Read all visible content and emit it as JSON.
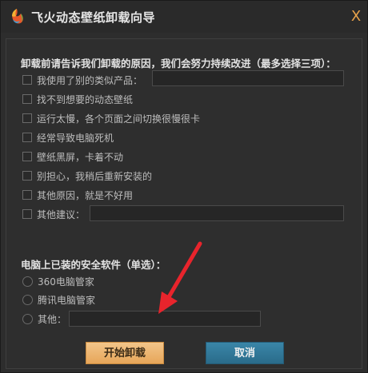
{
  "window": {
    "title": "飞火动态壁纸卸载向导",
    "close_glyph": "X"
  },
  "reasons": {
    "heading": "卸载前请告诉我们卸载的原因，我们会努力持续改进（最多选择三项）：",
    "options": [
      {
        "label": "我使用了别的类似产品：",
        "checked": false
      },
      {
        "label": "找不到想要的动态壁纸",
        "checked": false
      },
      {
        "label": "运行太慢，各个页面之间切换很慢很卡",
        "checked": false
      },
      {
        "label": "经常导致电脑死机",
        "checked": false
      },
      {
        "label": "壁纸黑屏，卡着不动",
        "checked": false
      },
      {
        "label": "别担心，我稍后重新安装的",
        "checked": false
      },
      {
        "label": "其他原因，就是不好用",
        "checked": false
      },
      {
        "label": "其他建议：",
        "checked": false
      }
    ],
    "similar_product_value": "",
    "suggestion_value": ""
  },
  "security": {
    "heading": "电脑上已装的安全软件（单选）：",
    "options": [
      {
        "label": "360电脑管家",
        "selected": false
      },
      {
        "label": "腾讯电脑管家",
        "selected": false
      },
      {
        "label": "其他：",
        "selected": false
      }
    ],
    "other_value": ""
  },
  "buttons": {
    "start": "开始卸载",
    "cancel": "取消"
  },
  "colors": {
    "start_button": "#e7a659",
    "cancel_button": "#2a6b8a",
    "annotation_arrow": "#e8242c",
    "close_icon": "#e8a24a"
  }
}
